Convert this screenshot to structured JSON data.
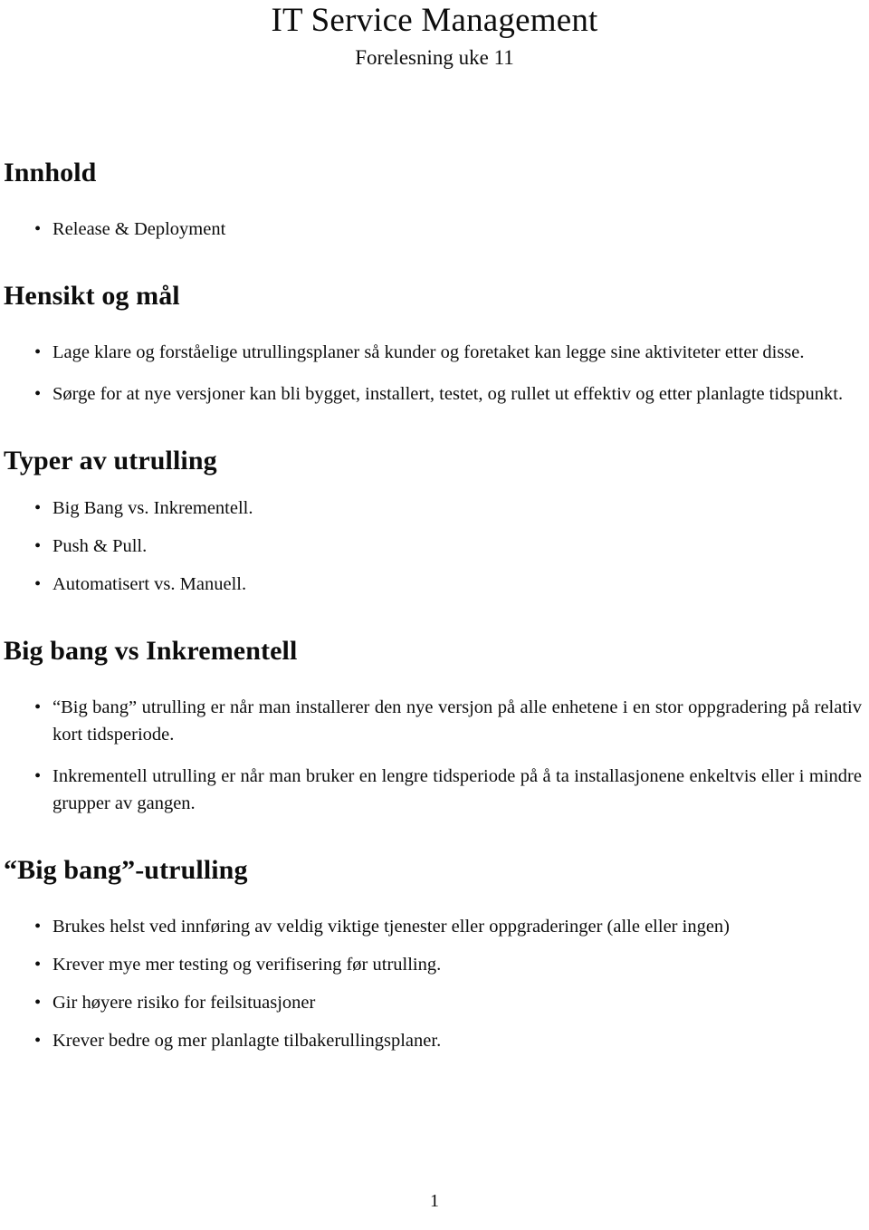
{
  "document": {
    "title": "IT Service Management",
    "subtitle": "Forelesning uke 11",
    "page_number": "1"
  },
  "sections": [
    {
      "heading": "Innhold",
      "bullet_glyph": "•",
      "items": [
        "Release & Deployment"
      ]
    },
    {
      "heading": "Hensikt og mål",
      "bullet_glyph": "•",
      "items": [
        "Lage klare og forståelige utrullingsplaner så kunder og foretaket kan legge sine aktiviteter etter disse.",
        "Sørge for at nye versjoner kan bli bygget, installert, testet, og rullet ut effektiv og etter planlagte tidspunkt."
      ]
    },
    {
      "heading": "Typer av utrulling",
      "bullet_glyph": "•",
      "items": [
        "Big Bang vs. Inkrementell.",
        "Push & Pull.",
        "Automatisert vs. Manuell."
      ]
    },
    {
      "heading": "Big bang vs Inkrementell",
      "bullet_glyph": "•",
      "items": [
        "“Big bang” utrulling er når man installerer den nye versjon på alle enhetene i en stor oppgradering på relativ kort tidsperiode.",
        "Inkrementell utrulling er når man bruker en lengre tidsperiode på å ta installasjonene enkeltvis eller i mindre grupper av gangen."
      ]
    },
    {
      "heading": "“Big bang”-utrulling",
      "bullet_glyph": "•",
      "items": [
        "Brukes helst ved innføring av veldig viktige tjenester eller oppgraderinger (alle eller ingen)",
        "Krever mye mer testing og verifisering før utrulling.",
        "Gir høyere risiko for feilsituasjoner",
        "Krever bedre og mer planlagte tilbakerullingsplaner."
      ]
    }
  ]
}
